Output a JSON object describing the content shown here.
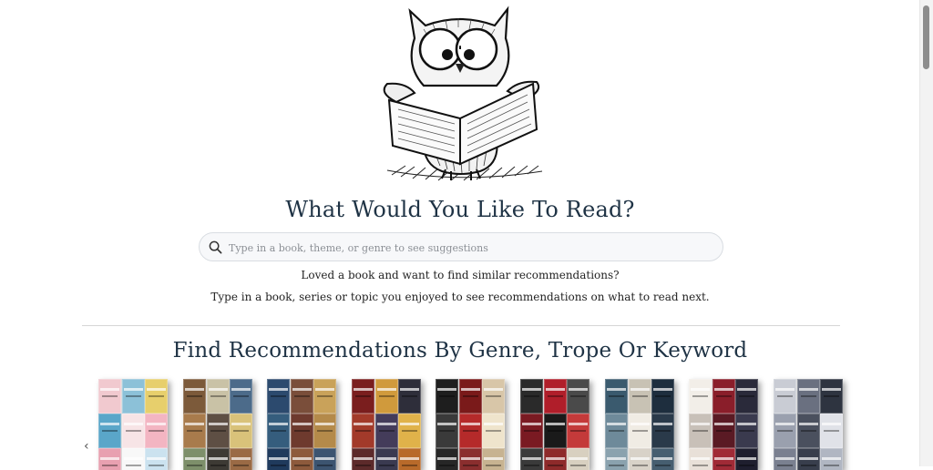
{
  "hero": {
    "title": "What Would You Like To Read?",
    "search_placeholder": "Type in a book, theme, or genre to see suggestions",
    "intro_line1": "Loved a book and want to find similar recommendations?",
    "intro_line2": "Type in a book, series or topic you enjoyed to see recommendations on what to read next."
  },
  "genres": {
    "title": "Find Recommendations By Genre, Trope Or Keyword",
    "prev_arrow": "‹",
    "next_arrow": "›",
    "cards": [
      {
        "colors": [
          "#f1c9cf",
          "#8cc1d8",
          "#e7cf6c",
          "#5aa6c9",
          "#f7e4e6",
          "#f3b5c2",
          "#e8a0b0",
          "#f8f8f8",
          "#cbe2ef"
        ]
      },
      {
        "colors": [
          "#7c5a3a",
          "#c9c2a6",
          "#4c6b8a",
          "#a87b4c",
          "#5e4f44",
          "#d9c27a",
          "#7d8f6a",
          "#3d3a34",
          "#9a6a45"
        ]
      },
      {
        "colors": [
          "#2c4a6e",
          "#7a4e3a",
          "#c9a25a",
          "#355d7d",
          "#6e3a2e",
          "#b48a4a",
          "#1f3a5c",
          "#8d5a3c",
          "#3c5470"
        ]
      },
      {
        "colors": [
          "#7a1e1e",
          "#d09a3c",
          "#2e2e3a",
          "#a23a2a",
          "#443c5a",
          "#e0b24a",
          "#5c2a2a",
          "#3a3a50",
          "#b86a2a"
        ]
      },
      {
        "colors": [
          "#1e1e1e",
          "#7a1a1a",
          "#d8c6a8",
          "#3a3a3a",
          "#b52a2a",
          "#efe4cc",
          "#262626",
          "#8a2e2e",
          "#c7b391"
        ]
      },
      {
        "colors": [
          "#2a2a2a",
          "#b01e2a",
          "#4a4a4a",
          "#7a1a22",
          "#1a1a1a",
          "#c43a3a",
          "#3a3a3a",
          "#8e2a2a",
          "#d8d0c0"
        ]
      },
      {
        "colors": [
          "#3a5a6e",
          "#c8c2b4",
          "#1e2e3e",
          "#6e8a9a",
          "#f0ece4",
          "#2a3a4a",
          "#8aa2ae",
          "#d8d2c8",
          "#465e70"
        ]
      },
      {
        "colors": [
          "#f2eee8",
          "#8a1e2a",
          "#2a2a3a",
          "#c8c0b8",
          "#5a1a24",
          "#3a3a4e",
          "#e8e0d8",
          "#a02a36",
          "#1e1e2e"
        ]
      },
      {
        "colors": [
          "#c9ccd4",
          "#6a7080",
          "#2e3440",
          "#9aa0ae",
          "#4a505e",
          "#e0e2e8",
          "#7a8090",
          "#383e4c",
          "#b0b6c2"
        ]
      }
    ]
  },
  "colors": {
    "heading": "#1f3345",
    "search_bg": "#f7f8fa",
    "search_border": "#d9dde2",
    "divider": "#d6d6d6"
  }
}
